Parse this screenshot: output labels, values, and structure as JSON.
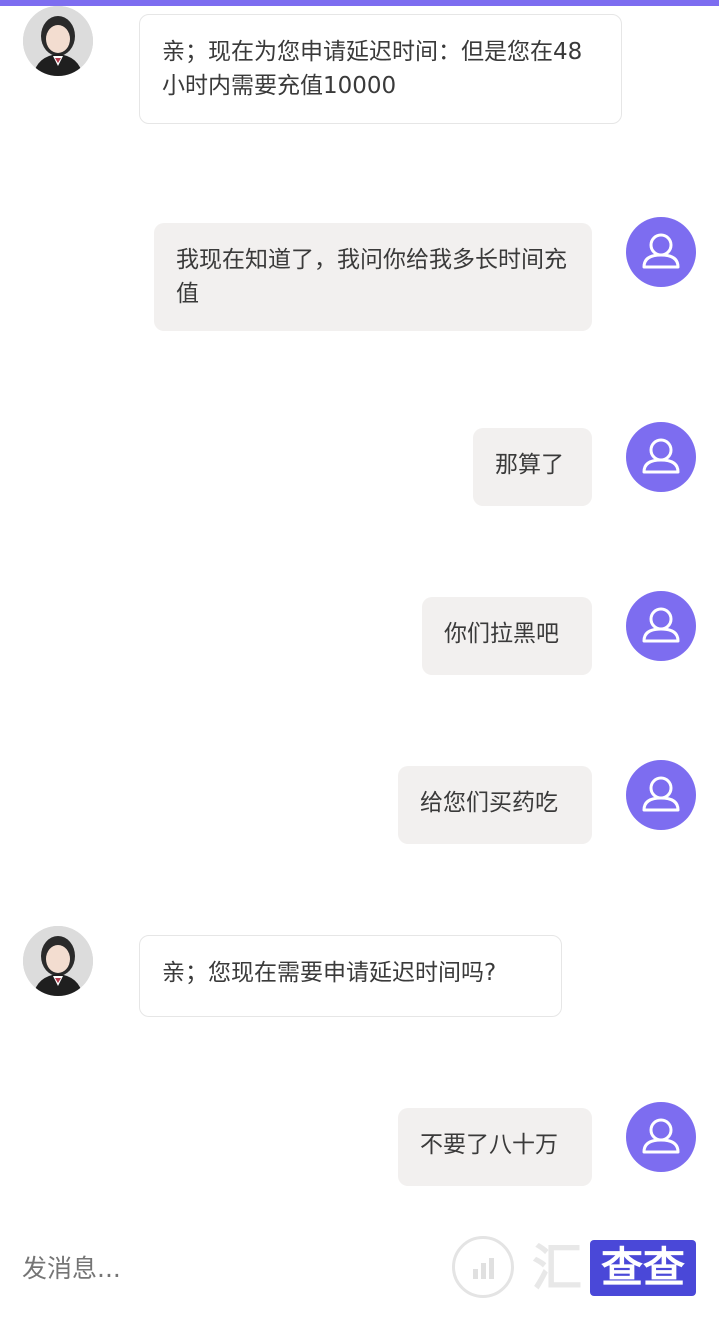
{
  "messages": [
    {
      "sender": "agent",
      "text": "亲；现在为您申请延迟时间：但是您在48小时内需要充值10000"
    },
    {
      "sender": "user",
      "text": "我现在知道了，我问你给我多长时间充值"
    },
    {
      "sender": "user",
      "text": "那算了"
    },
    {
      "sender": "user",
      "text": "你们拉黑吧"
    },
    {
      "sender": "user",
      "text": "给您们买药吃"
    },
    {
      "sender": "agent",
      "text": "亲；您现在需要申请延迟时间吗?"
    },
    {
      "sender": "user",
      "text": "不要了八十万"
    }
  ],
  "input": {
    "placeholder": "发消息..."
  },
  "watermark": {
    "text_left": "汇",
    "text_box": "查查"
  },
  "icons": {
    "agent_avatar": "agent-avatar-photo",
    "user_avatar": "user-icon"
  },
  "colors": {
    "accent": "#7d6df0",
    "user_bubble": "#f2f0ef",
    "agent_bubble": "#ffffff"
  }
}
